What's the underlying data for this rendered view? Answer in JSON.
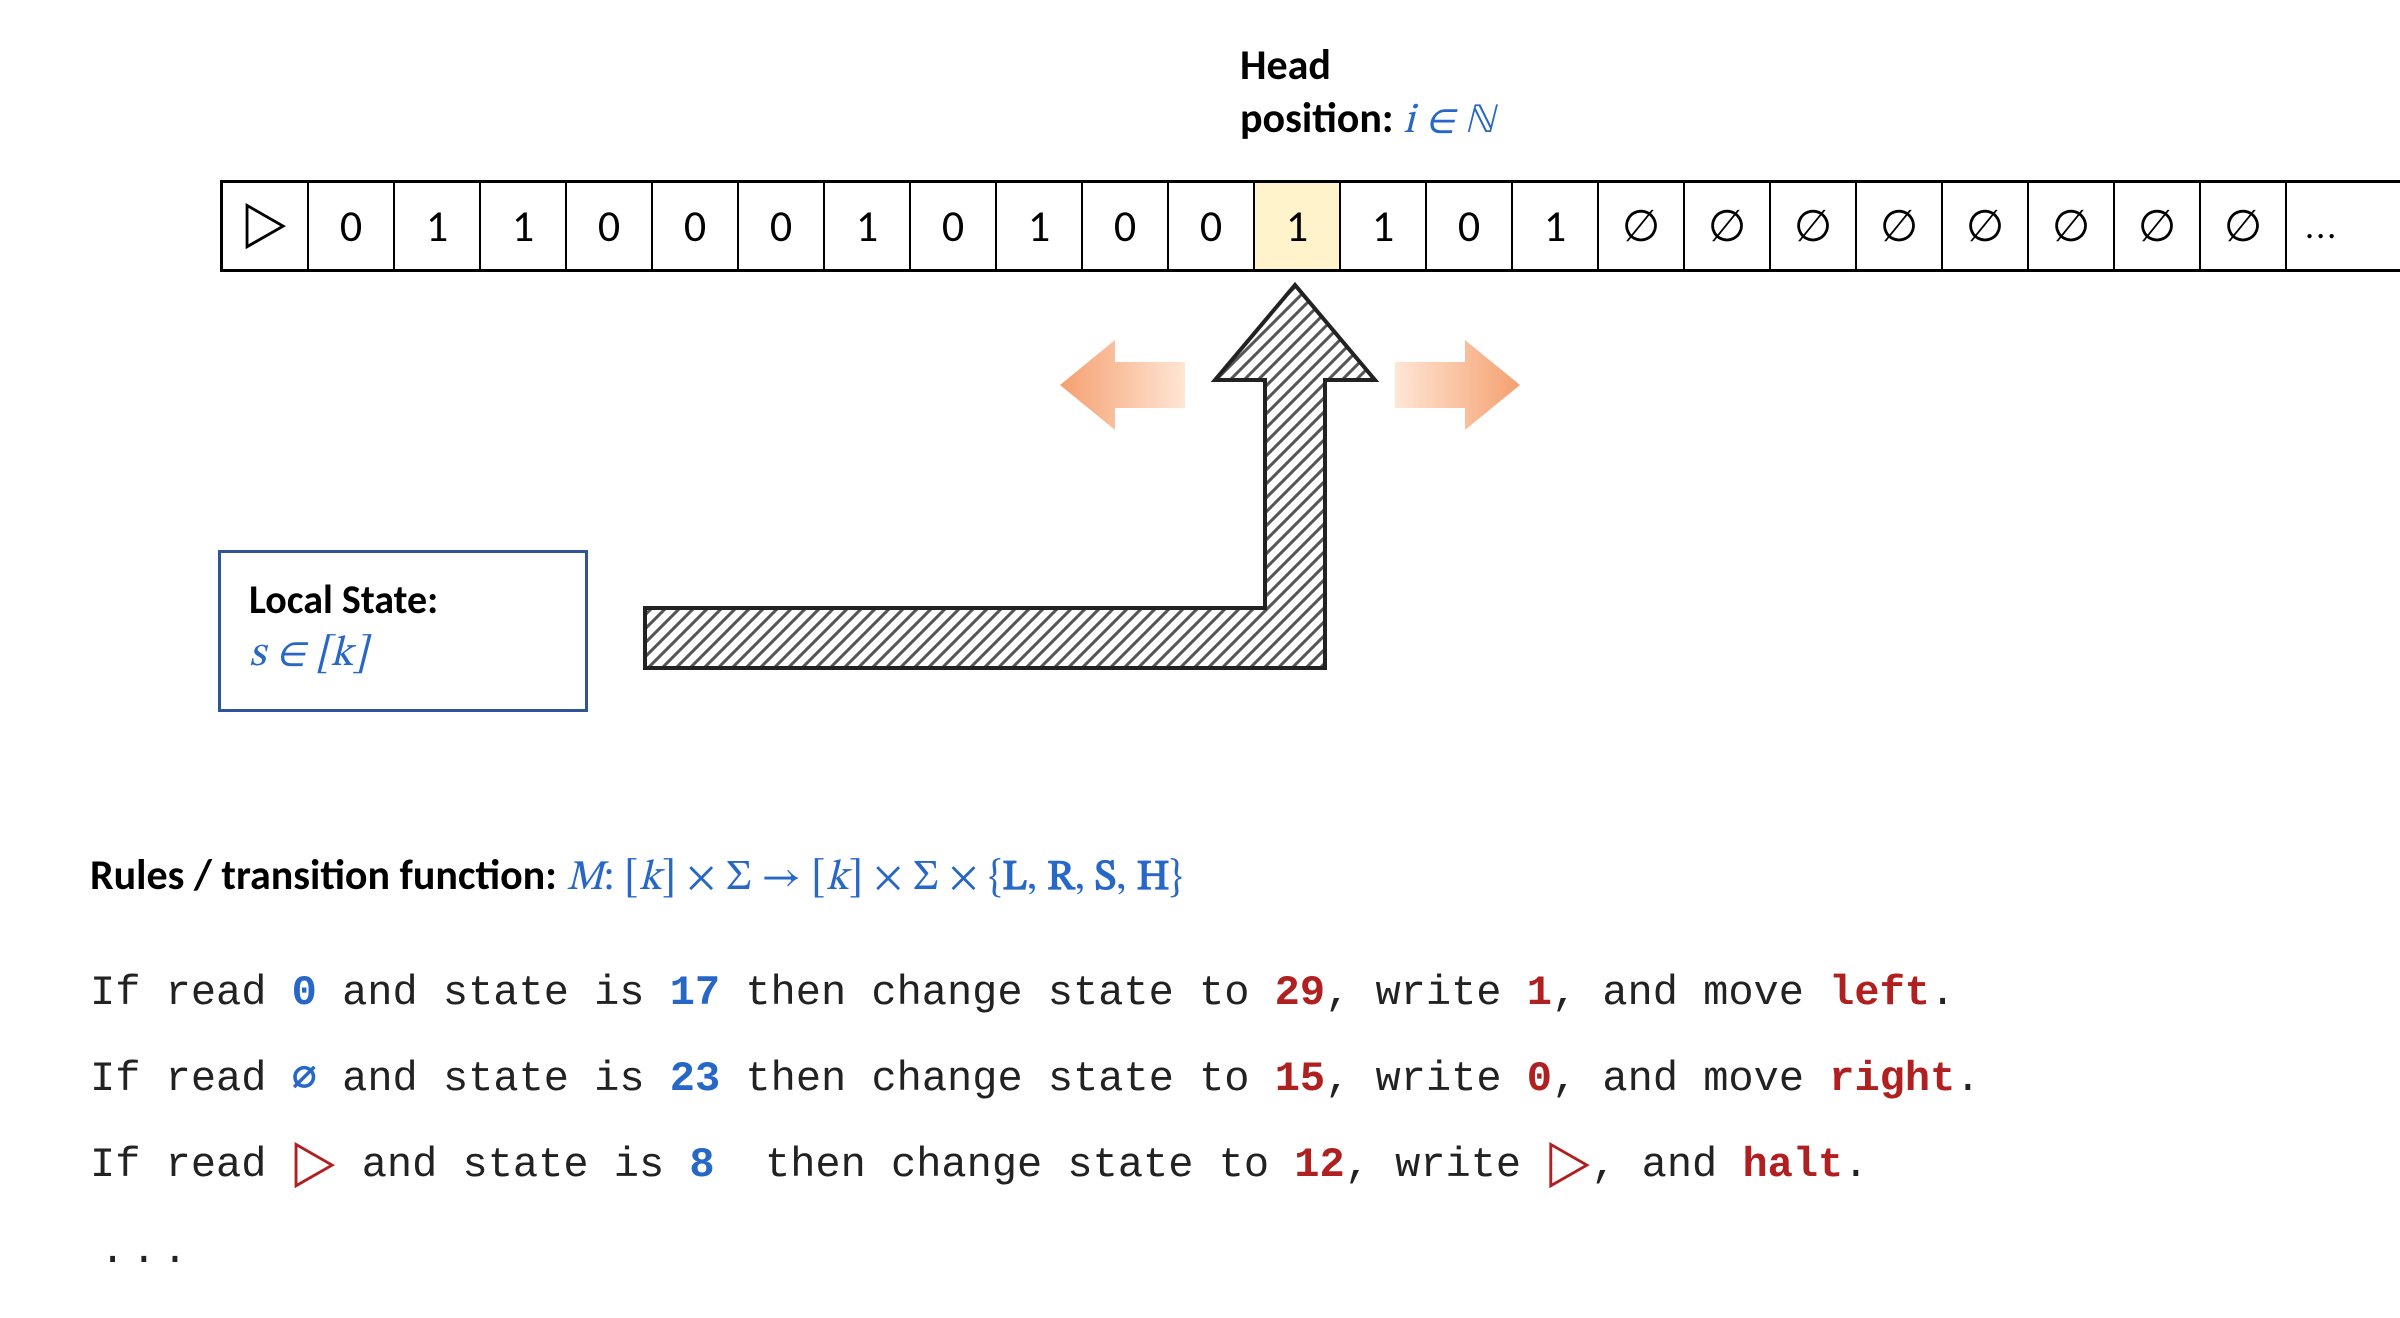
{
  "head_label": {
    "line1": "Head",
    "line2_prefix": "position: ",
    "line2_math": "i ∈ ℕ"
  },
  "tape": {
    "highlight_index": 12,
    "cells": [
      "▷",
      "0",
      "1",
      "1",
      "0",
      "0",
      "0",
      "1",
      "0",
      "1",
      "0",
      "0",
      "1",
      "1",
      "0",
      "1",
      "∅",
      "∅",
      "∅",
      "∅",
      "∅",
      "∅",
      "∅",
      "∅",
      "..."
    ]
  },
  "local_state": {
    "title": "Local State:",
    "math": "s ∈ [k]"
  },
  "rules_heading": {
    "label": "Rules / transition function: ",
    "math_html": "<span class='it'>M</span>: [<span class='it'>k</span>] × Σ → [<span class='it'>k</span>] × Σ × {<span class='bset'>L</span>, <span class='bset'>R</span>, <span class='bset'>S</span>, <span class='bset'>H</span>}"
  },
  "rules": [
    {
      "read": "0",
      "read_class": "blue",
      "state_in": "17",
      "state_out": "29",
      "write": "1",
      "write_class": "red",
      "move": "left",
      "move_class": "red"
    },
    {
      "read": "∅",
      "read_class": "blue-empty",
      "state_in": "23",
      "state_out": "15",
      "write": "0",
      "write_class": "red",
      "move": "right",
      "move_class": "red"
    },
    {
      "read": "▷",
      "read_class": "red-tri",
      "state_in": "8",
      "state_out": "12",
      "write": "▷",
      "write_class": "red-tri",
      "move": "halt",
      "move_class": "red"
    }
  ],
  "ellipsis": "..."
}
